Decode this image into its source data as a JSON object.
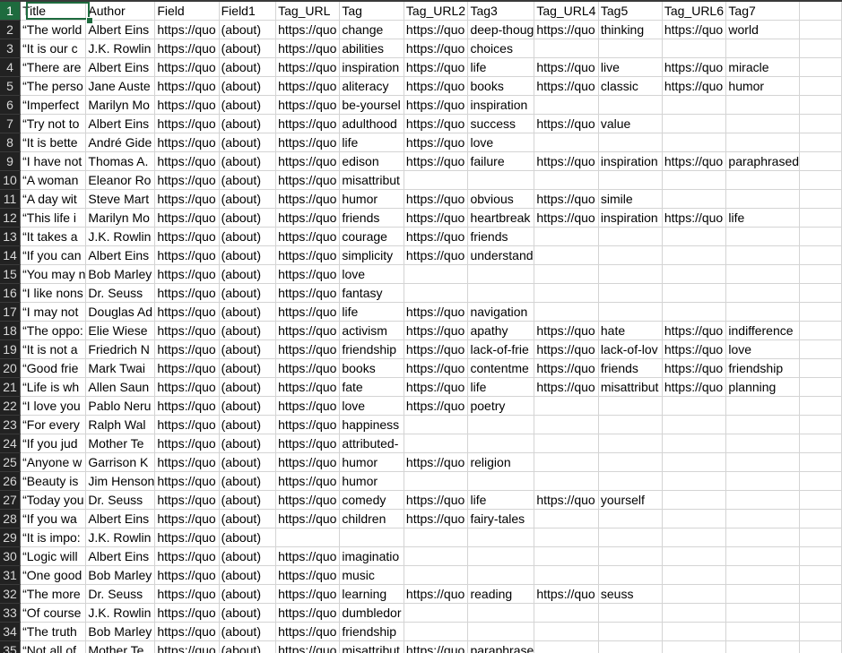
{
  "sheet": {
    "selected_cell": "A1",
    "accent_color": "#1e6b3e",
    "headers": [
      "Title",
      "Author",
      "Field",
      "Field1",
      "Tag_URL",
      "Tag",
      "Tag_URL2",
      "Tag3",
      "Tag_URL4",
      "Tag5",
      "Tag_URL6",
      "Tag7",
      ""
    ],
    "rows": [
      {
        "n": "2",
        "cells": [
          "“The world",
          "Albert Eins",
          "https://quo",
          "(about)",
          "https://quo",
          "change",
          "https://quo",
          "deep-thoug",
          "https://quo",
          "thinking",
          "https://quo",
          "world",
          ""
        ]
      },
      {
        "n": "3",
        "cells": [
          "“It is our c",
          "J.K. Rowlin",
          "https://quo",
          "(about)",
          "https://quo",
          "abilities",
          "https://quo",
          "choices",
          "",
          "",
          "",
          "",
          ""
        ]
      },
      {
        "n": "4",
        "cells": [
          "“There are",
          "Albert Eins",
          "https://quo",
          "(about)",
          "https://quo",
          "inspiration",
          "https://quo",
          "life",
          "https://quo",
          "live",
          "https://quo",
          "miracle",
          ""
        ]
      },
      {
        "n": "5",
        "cells": [
          "“The perso",
          "Jane Auste",
          "https://quo",
          "(about)",
          "https://quo",
          "aliteracy",
          "https://quo",
          "books",
          "https://quo",
          "classic",
          "https://quo",
          "humor",
          ""
        ]
      },
      {
        "n": "6",
        "cells": [
          "“Imperfect",
          "Marilyn Mo",
          "https://quo",
          "(about)",
          "https://quo",
          "be-yoursel",
          "https://quo",
          "inspiration",
          "",
          "",
          "",
          "",
          ""
        ]
      },
      {
        "n": "7",
        "cells": [
          "“Try not to",
          "Albert Eins",
          "https://quo",
          "(about)",
          "https://quo",
          "adulthood",
          "https://quo",
          "success",
          "https://quo",
          "value",
          "",
          "",
          ""
        ]
      },
      {
        "n": "8",
        "cells": [
          "“It is bette",
          "André Gide",
          "https://quo",
          "(about)",
          "https://quo",
          "life",
          "https://quo",
          "love",
          "",
          "",
          "",
          "",
          ""
        ]
      },
      {
        "n": "9",
        "cells": [
          "“I have not",
          "Thomas A.",
          "https://quo",
          "(about)",
          "https://quo",
          "edison",
          "https://quo",
          "failure",
          "https://quo",
          "inspiration",
          "https://quo",
          "paraphrased",
          ""
        ]
      },
      {
        "n": "10",
        "cells": [
          "“A woman",
          "Eleanor Ro",
          "https://quo",
          "(about)",
          "https://quo",
          "misattribut",
          "",
          "",
          "",
          "",
          "",
          "",
          ""
        ]
      },
      {
        "n": "11",
        "cells": [
          "“A day wit",
          "Steve Mart",
          "https://quo",
          "(about)",
          "https://quo",
          "humor",
          "https://quo",
          "obvious",
          "https://quo",
          "simile",
          "",
          "",
          ""
        ]
      },
      {
        "n": "12",
        "cells": [
          "“This life i",
          "Marilyn Mo",
          "https://quo",
          "(about)",
          "https://quo",
          "friends",
          "https://quo",
          "heartbreak",
          "https://quo",
          "inspiration",
          "https://quo",
          "life",
          ""
        ]
      },
      {
        "n": "13",
        "cells": [
          "“It takes a",
          "J.K. Rowlin",
          "https://quo",
          "(about)",
          "https://quo",
          "courage",
          "https://quo",
          "friends",
          "",
          "",
          "",
          "",
          ""
        ]
      },
      {
        "n": "14",
        "cells": [
          "“If you can",
          "Albert Eins",
          "https://quo",
          "(about)",
          "https://quo",
          "simplicity",
          "https://quo",
          "understand",
          "",
          "",
          "",
          "",
          ""
        ]
      },
      {
        "n": "15",
        "cells": [
          "“You may n",
          "Bob Marley",
          "https://quo",
          "(about)",
          "https://quo",
          "love",
          "",
          "",
          "",
          "",
          "",
          "",
          ""
        ]
      },
      {
        "n": "16",
        "cells": [
          "“I like nons",
          "Dr. Seuss",
          "https://quo",
          "(about)",
          "https://quo",
          "fantasy",
          "",
          "",
          "",
          "",
          "",
          "",
          ""
        ]
      },
      {
        "n": "17",
        "cells": [
          "“I may not",
          "Douglas Ad",
          "https://quo",
          "(about)",
          "https://quo",
          "life",
          "https://quo",
          "navigation",
          "",
          "",
          "",
          "",
          ""
        ]
      },
      {
        "n": "18",
        "cells": [
          "“The oppo:",
          "Elie Wiese",
          "https://quo",
          "(about)",
          "https://quo",
          "activism",
          "https://quo",
          "apathy",
          "https://quo",
          "hate",
          "https://quo",
          "indifference",
          ""
        ]
      },
      {
        "n": "19",
        "cells": [
          "“It is not a",
          "Friedrich N",
          "https://quo",
          "(about)",
          "https://quo",
          "friendship",
          "https://quo",
          "lack-of-frie",
          "https://quo",
          "lack-of-lov",
          "https://quo",
          "love",
          ""
        ]
      },
      {
        "n": "20",
        "cells": [
          "“Good frie",
          "Mark Twai",
          "https://quo",
          "(about)",
          "https://quo",
          "books",
          "https://quo",
          "contentme",
          "https://quo",
          "friends",
          "https://quo",
          "friendship",
          ""
        ]
      },
      {
        "n": "21",
        "cells": [
          "“Life is wh",
          "Allen Saun",
          "https://quo",
          "(about)",
          "https://quo",
          "fate",
          "https://quo",
          "life",
          "https://quo",
          "misattribut",
          "https://quo",
          "planning",
          ""
        ]
      },
      {
        "n": "22",
        "cells": [
          "“I love you",
          "Pablo Neru",
          "https://quo",
          "(about)",
          "https://quo",
          "love",
          "https://quo",
          "poetry",
          "",
          "",
          "",
          "",
          ""
        ]
      },
      {
        "n": "23",
        "cells": [
          "“For every",
          "Ralph Wal",
          "https://quo",
          "(about)",
          "https://quo",
          "happiness",
          "",
          "",
          "",
          "",
          "",
          "",
          ""
        ]
      },
      {
        "n": "24",
        "cells": [
          "“If you jud",
          "Mother Te",
          "https://quo",
          "(about)",
          "https://quo",
          "attributed-",
          "",
          "",
          "",
          "",
          "",
          "",
          ""
        ]
      },
      {
        "n": "25",
        "cells": [
          "“Anyone w",
          "Garrison K",
          "https://quo",
          "(about)",
          "https://quo",
          "humor",
          "https://quo",
          "religion",
          "",
          "",
          "",
          "",
          ""
        ]
      },
      {
        "n": "26",
        "cells": [
          "“Beauty is",
          "Jim Henson",
          "https://quo",
          "(about)",
          "https://quo",
          "humor",
          "",
          "",
          "",
          "",
          "",
          "",
          ""
        ]
      },
      {
        "n": "27",
        "cells": [
          "“Today you",
          "Dr. Seuss",
          "https://quo",
          "(about)",
          "https://quo",
          "comedy",
          "https://quo",
          "life",
          "https://quo",
          "yourself",
          "",
          "",
          ""
        ]
      },
      {
        "n": "28",
        "cells": [
          "“If you wa",
          "Albert Eins",
          "https://quo",
          "(about)",
          "https://quo",
          "children",
          "https://quo",
          "fairy-tales",
          "",
          "",
          "",
          "",
          ""
        ]
      },
      {
        "n": "29",
        "cells": [
          "“It is impo:",
          "J.K. Rowlin",
          "https://quo",
          "(about)",
          "",
          "",
          "",
          "",
          "",
          "",
          "",
          "",
          ""
        ]
      },
      {
        "n": "30",
        "cells": [
          "“Logic will",
          "Albert Eins",
          "https://quo",
          "(about)",
          "https://quo",
          "imaginatio",
          "",
          "",
          "",
          "",
          "",
          "",
          ""
        ]
      },
      {
        "n": "31",
        "cells": [
          "“One good",
          "Bob Marley",
          "https://quo",
          "(about)",
          "https://quo",
          "music",
          "",
          "",
          "",
          "",
          "",
          "",
          ""
        ]
      },
      {
        "n": "32",
        "cells": [
          "“The more",
          "Dr. Seuss",
          "https://quo",
          "(about)",
          "https://quo",
          "learning",
          "https://quo",
          "reading",
          "https://quo",
          "seuss",
          "",
          "",
          ""
        ]
      },
      {
        "n": "33",
        "cells": [
          "“Of course",
          "J.K. Rowlin",
          "https://quo",
          "(about)",
          "https://quo",
          "dumbledor",
          "",
          "",
          "",
          "",
          "",
          "",
          ""
        ]
      },
      {
        "n": "34",
        "cells": [
          "“The truth",
          "Bob Marley",
          "https://quo",
          "(about)",
          "https://quo",
          "friendship",
          "",
          "",
          "",
          "",
          "",
          "",
          ""
        ]
      },
      {
        "n": "35",
        "cells": [
          "“Not all of",
          "Mother Te",
          "https://quo",
          "(about)",
          "https://quo",
          "misattribut",
          "https://quo",
          "paraphrase",
          "",
          "",
          "",
          "",
          ""
        ]
      }
    ]
  }
}
